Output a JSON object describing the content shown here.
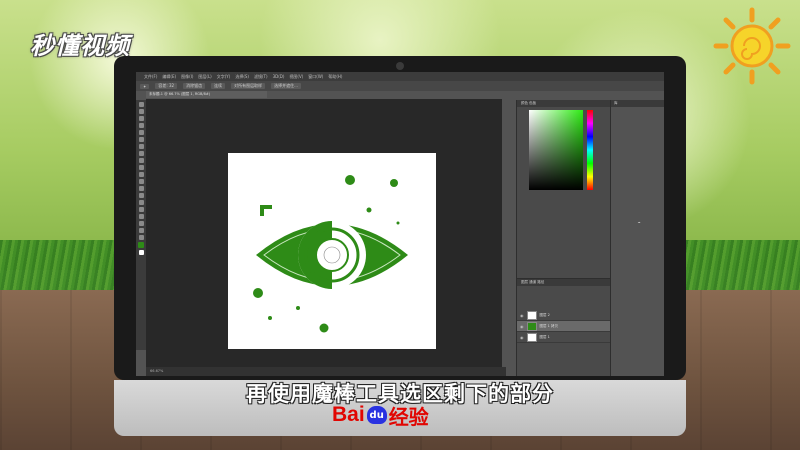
{
  "watermark": {
    "logo_text": "秒懂视频"
  },
  "photoshop": {
    "menu": [
      "文件(F)",
      "编辑(E)",
      "图像(I)",
      "图层(L)",
      "文字(Y)",
      "选择(S)",
      "滤镜(T)",
      "3D(D)",
      "视图(V)",
      "窗口(W)",
      "帮助(H)"
    ],
    "options": [
      "容差: 32",
      "消除锯齿",
      "连续",
      "对所有图层取样",
      "选择并遮住..."
    ],
    "doc_tab": "未标题-1 @ 66.7% (图层 1, RGB/8#)",
    "panel_tabs_top": [
      "颜色",
      "色板"
    ],
    "layers_tabs": [
      "图层",
      "通道",
      "路径"
    ],
    "layers": [
      {
        "name": "图层 2"
      },
      {
        "name": "图层 1 拷贝"
      },
      {
        "name": "图层 1"
      }
    ],
    "libs_title": "库",
    "status": "66.67%"
  },
  "colors": {
    "accent_green": "#2e8b17",
    "ps_dark": "#282828"
  },
  "subtitle": "再使用魔棒工具选区剩下的部分",
  "brand": {
    "bai": "Bai",
    "du": "du",
    "jingyan": "经验"
  }
}
